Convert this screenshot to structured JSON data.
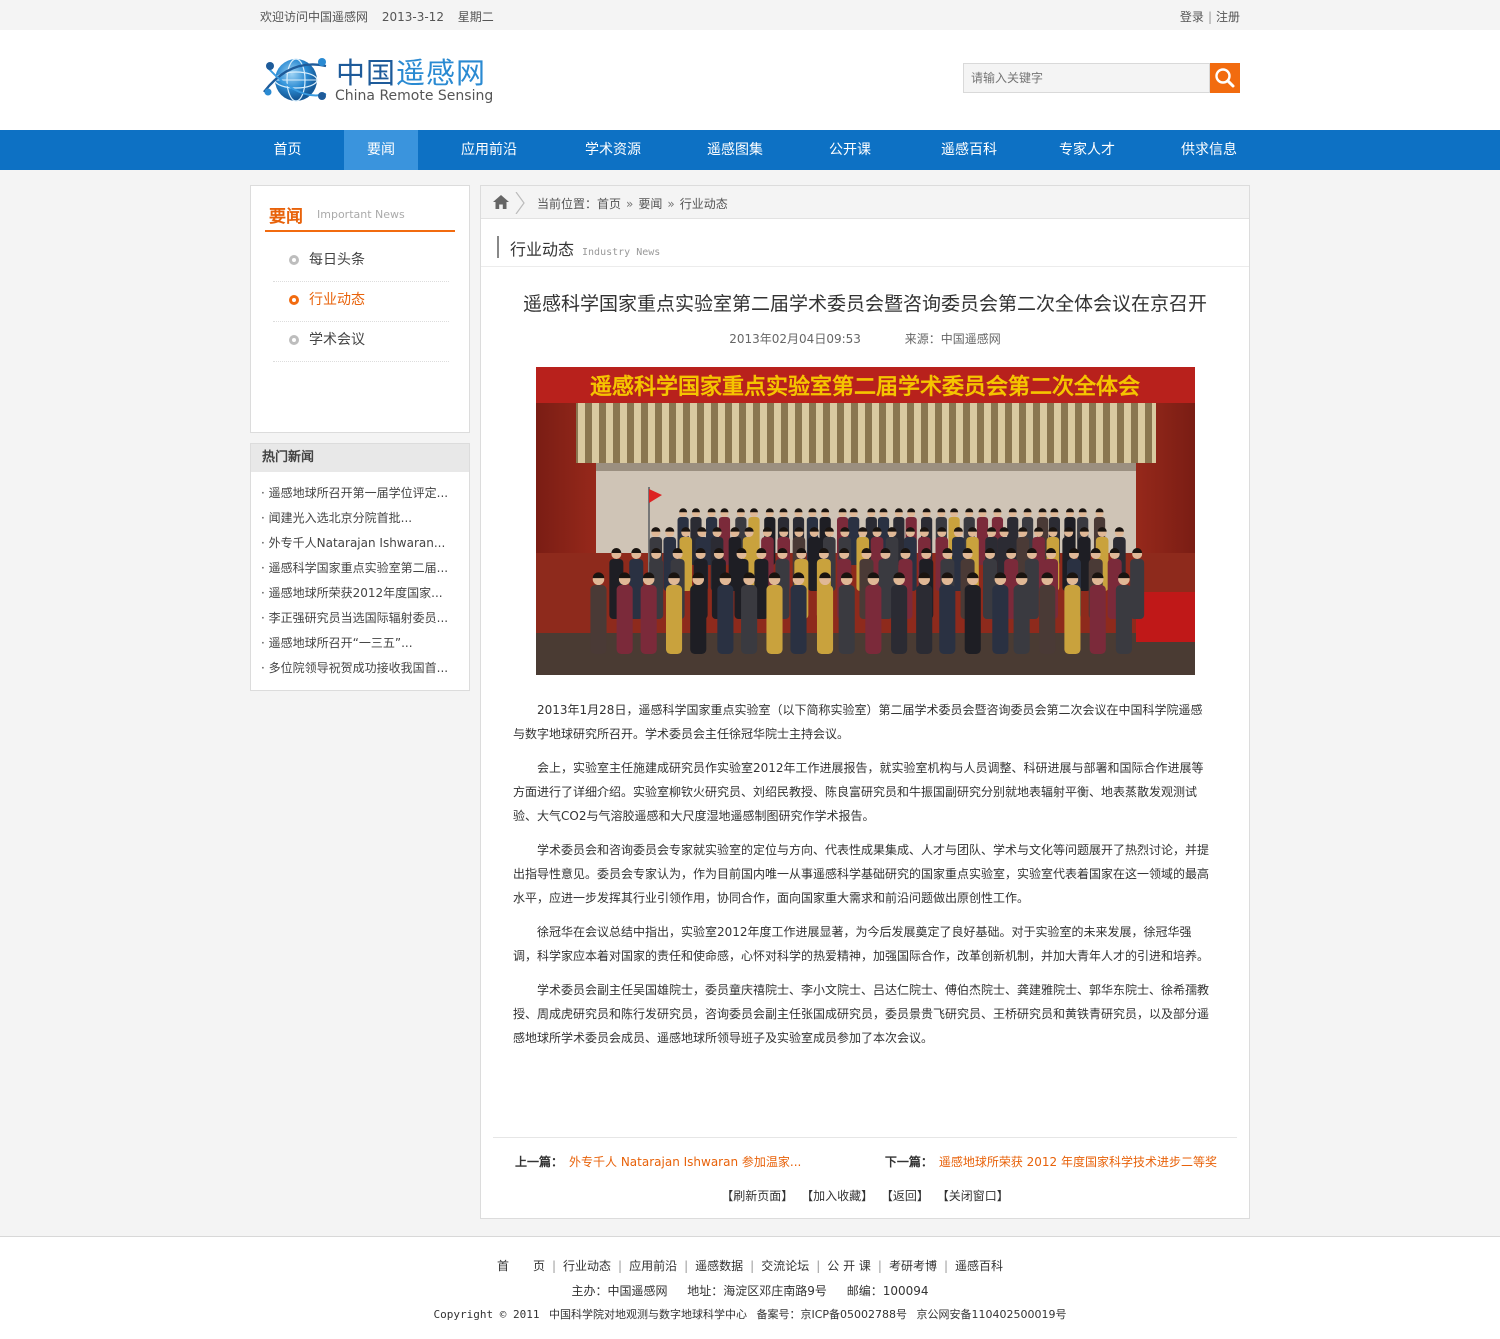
{
  "topbar": {
    "welcome": "欢迎访问中国遥感网",
    "date": "2013-3-12",
    "weekday": "星期二",
    "login": "登录",
    "separator": "|",
    "register": "注册"
  },
  "header": {
    "logo_cn_a": "中国",
    "logo_cn_b": "遥感网",
    "logo_en": "China Remote Sensing",
    "search_placeholder": "请输入关键字"
  },
  "nav": {
    "items": [
      {
        "label": "首页"
      },
      {
        "label": "要闻"
      },
      {
        "label": "应用前沿"
      },
      {
        "label": "学术资源"
      },
      {
        "label": "遥感图集"
      },
      {
        "label": "公开课"
      },
      {
        "label": "遥感百科"
      },
      {
        "label": "专家人才"
      },
      {
        "label": "供求信息"
      }
    ],
    "active": "要闻"
  },
  "sidebar": {
    "title_cn": "要闻",
    "title_en": "Important News",
    "items": [
      {
        "label": "每日头条"
      },
      {
        "label": "行业动态"
      },
      {
        "label": "学术会议"
      }
    ],
    "active": "行业动态"
  },
  "hot": {
    "title": "热门新闻",
    "items": [
      {
        "label": "· 遥感地球所召开第一届学位评定..."
      },
      {
        "label": "· 闻建光入选北京分院首批..."
      },
      {
        "label": "· 外专千人Natarajan Ishwaran..."
      },
      {
        "label": "· 遥感科学国家重点实验室第二届..."
      },
      {
        "label": "· 遥感地球所荣获2012年度国家..."
      },
      {
        "label": "· 李正强研究员当选国际辐射委员..."
      },
      {
        "label": "· 遥感地球所召开“一三五”..."
      },
      {
        "label": "· 多位院领导祝贺成功接收我国首..."
      }
    ]
  },
  "breadcrumb": {
    "prefix": "当前位置：",
    "items": [
      "首页",
      "要闻",
      "行业动态"
    ],
    "arrow": "»"
  },
  "section": {
    "title_cn": "行业动态",
    "title_en": "Industry News"
  },
  "article": {
    "title": "遥感科学国家重点实验室第二届学术委员会暨咨询委员会第二次全体会议在京召开",
    "datetime": "2013年02月04日09:53",
    "source": "来源：中国遥感网",
    "banner_text": "遥感科学国家重点实验室第二届学术委员会第二次全体会",
    "paragraphs": [
      "2013年1月28日，遥感科学国家重点实验室（以下简称实验室）第二届学术委员会暨咨询委员会第二次会议在中国科学院遥感与数字地球研究所召开。学术委员会主任徐冠华院士主持会议。",
      "会上，实验室主任施建成研究员作实验室2012年工作进展报告，就实验室机构与人员调整、科研进展与部署和国际合作进展等方面进行了详细介绍。实验室柳钦火研究员、刘绍民教授、陈良富研究员和牛振国副研究分别就地表辐射平衡、地表蒸散发观测试验、大气CO2与气溶胶遥感和大尺度湿地遥感制图研究作学术报告。",
      "学术委员会和咨询委员会专家就实验室的定位与方向、代表性成果集成、人才与团队、学术与文化等问题展开了热烈讨论，并提出指导性意见。委员会专家认为，作为目前国内唯一从事遥感科学基础研究的国家重点实验室，实验室代表着国家在这一领域的最高水平，应进一步发挥其行业引领作用，协同合作，面向国家重大需求和前沿问题做出原创性工作。",
      "徐冠华在会议总结中指出，实验室2012年度工作进展显著，为今后发展奠定了良好基础。对于实验室的未来发展，徐冠华强调，科学家应本着对国家的责任和使命感，心怀对科学的热爱精神，加强国际合作，改革创新机制，并加大青年人才的引进和培养。",
      "学术委员会副主任吴国雄院士，委员童庆禧院士、李小文院士、吕达仁院士、傅伯杰院士、龚建雅院士、郭华东院士、徐希孺教授、周成虎研究员和陈行发研究员，咨询委员会副主任张国成研究员，委员景贵飞研究员、王桥研究员和黄铁青研究员，以及部分遥感地球所学术委员会成员、遥感地球所领导班子及实验室成员参加了本次会议。"
    ]
  },
  "pager": {
    "prev_label": "上一篇：",
    "prev_title": "外专千人 Natarajan Ishwaran 参加温家...",
    "next_label": "下一篇：",
    "next_title": "遥感地球所荣获 2012 年度国家科学技术进步二等奖"
  },
  "actions": [
    "【刷新页面】",
    "【加入收藏】",
    "【返回】",
    "【关闭窗口】"
  ],
  "footer": {
    "links": [
      "首　　页",
      "行业动态",
      "应用前沿",
      "遥感数据",
      "交流论坛",
      "公 开 课",
      "考研考博",
      "遥感百科"
    ],
    "sponsor": "主办：中国遥感网",
    "address": "地址：海淀区邓庄南路9号",
    "zip": "邮编：100094",
    "copyright": "Copyright © 2011",
    "org": "中国科学院对地观测与数字地球科学中心",
    "icp": "备案号：京ICP备05002788号",
    "police": "京公网安备110402500019号"
  },
  "colors": {
    "nav_blue": "#0d71c4",
    "nav_active": "#3a94dd",
    "accent_orange": "#f26b0f",
    "banner_red": "#b8211c",
    "banner_text": "#f5c400"
  }
}
